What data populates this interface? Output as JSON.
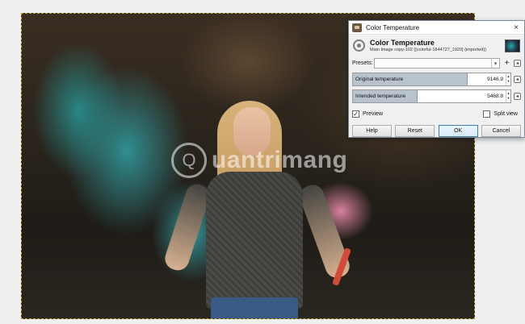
{
  "watermark": {
    "text": "uantrimang",
    "glyph": "Q"
  },
  "dialog": {
    "window_title": "Color Temperature",
    "heading": "Color Temperature",
    "subtitle": "Main Image copy-102 ([colorful-1844727_1920] (imported))",
    "close_glyph": "×",
    "presets": {
      "label": "Presets:",
      "value": "",
      "add_glyph": "+"
    },
    "original_temperature": {
      "label": "Original temperature",
      "value": "9146.9",
      "fill_fraction": 0.73
    },
    "intended_temperature": {
      "label": "Intended temperature",
      "value": "5468.8",
      "fill_fraction": 0.41
    },
    "preview": {
      "label": "Preview",
      "checked": true,
      "mark": "✓"
    },
    "split_view": {
      "label": "Split view",
      "checked": false
    },
    "buttons": {
      "help": "Help",
      "reset": "Reset",
      "ok": "OK",
      "cancel": "Cancel"
    }
  },
  "icons": {
    "app": "gimp-app-icon",
    "filter": "color-temperature-filter-icon",
    "close": "close-icon",
    "dropdown": "chevron-down-icon",
    "add_preset": "plus-icon",
    "menu": "menu-icon"
  }
}
